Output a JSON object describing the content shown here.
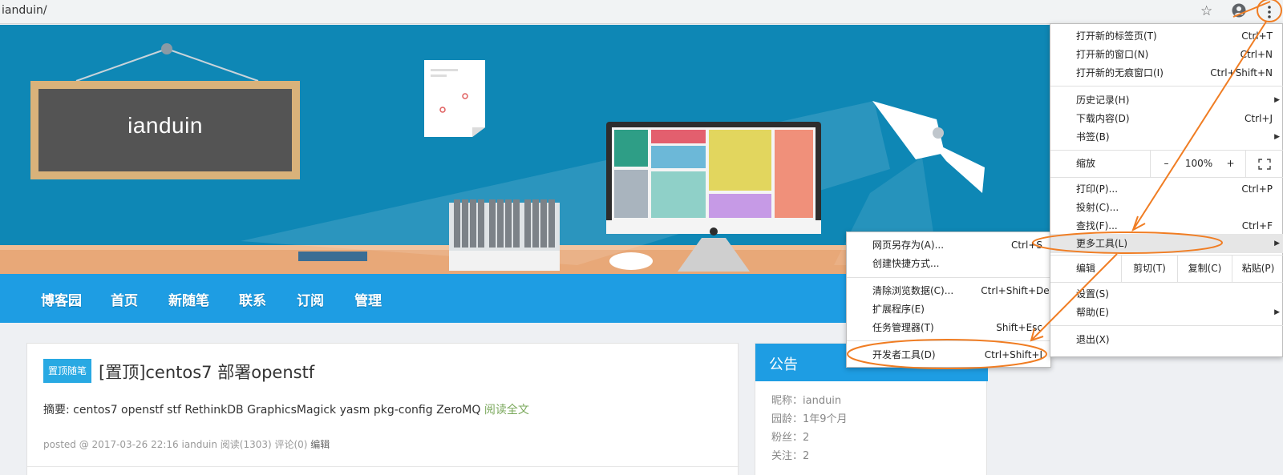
{
  "browser": {
    "url": "ianduin/",
    "icons": {
      "bookmark": "star-icon",
      "account": "account-circle-icon",
      "menu": "kebab-menu-icon"
    }
  },
  "banner": {
    "blog_title": "ianduin"
  },
  "nav": {
    "items": [
      "博客园",
      "首页",
      "新随笔",
      "联系",
      "订阅",
      "管理"
    ]
  },
  "post": {
    "badge": "置顶随笔",
    "title": "[置顶]centos7 部署openstf",
    "summary_label": "摘要:",
    "summary": " centos7 openstf stf RethinkDB GraphicsMagick yasm pkg-config ZeroMQ ",
    "read_more": "阅读全文",
    "meta": "posted @ 2017-03-26 22:16 ianduin 阅读(1303) 评论(0) ",
    "edit": "编辑"
  },
  "notice": {
    "title": "公告",
    "rows": [
      "昵称：ianduin",
      "园龄：1年9个月",
      "粉丝：2",
      "关注：2"
    ]
  },
  "chrome_menu": {
    "new_tab": {
      "label": "打开新的标签页(T)",
      "shortcut": "Ctrl+T"
    },
    "new_window": {
      "label": "打开新的窗口(N)",
      "shortcut": "Ctrl+N"
    },
    "new_incognito": {
      "label": "打开新的无痕窗口(I)",
      "shortcut": "Ctrl+Shift+N"
    },
    "history": {
      "label": "历史记录(H)"
    },
    "downloads": {
      "label": "下载内容(D)",
      "shortcut": "Ctrl+J"
    },
    "bookmarks": {
      "label": "书签(B)"
    },
    "zoom": {
      "label": "缩放",
      "minus": "–",
      "level": "100%",
      "plus": "+"
    },
    "print": {
      "label": "打印(P)...",
      "shortcut": "Ctrl+P"
    },
    "cast": {
      "label": "投射(C)..."
    },
    "find": {
      "label": "查找(F)...",
      "shortcut": "Ctrl+F"
    },
    "more_tools": {
      "label": "更多工具(L)"
    },
    "edit": {
      "label": "编辑",
      "cut": "剪切(T)",
      "copy": "复制(C)",
      "paste": "粘贴(P)"
    },
    "settings": {
      "label": "设置(S)"
    },
    "help": {
      "label": "帮助(E)"
    },
    "exit": {
      "label": "退出(X)"
    }
  },
  "more_tools_menu": {
    "save_page": {
      "label": "网页另存为(A)...",
      "shortcut": "Ctrl+S"
    },
    "create_shortcut": {
      "label": "创建快捷方式..."
    },
    "clear_data": {
      "label": "清除浏览数据(C)...",
      "shortcut": "Ctrl+Shift+Del"
    },
    "extensions": {
      "label": "扩展程序(E)"
    },
    "task_manager": {
      "label": "任务管理器(T)",
      "shortcut": "Shift+Esc"
    },
    "devtools": {
      "label": "开发者工具(D)",
      "shortcut": "Ctrl+Shift+I"
    }
  },
  "annotation": {
    "color": "#f07d23"
  }
}
